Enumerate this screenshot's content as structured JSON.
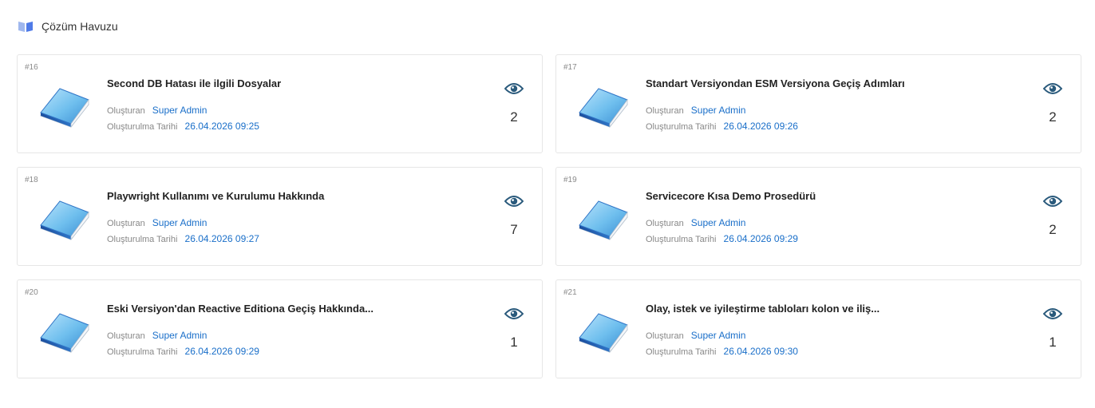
{
  "page": {
    "title": "Çözüm Havuzu",
    "icon": "open-book-icon"
  },
  "labels": {
    "created_by": "Oluşturan",
    "created_at": "Oluşturulma Tarihi"
  },
  "colors": {
    "link": "#1a6fc9",
    "eye": "#2a5a7c",
    "header_icon": "#4f7be8"
  },
  "articles": [
    {
      "id": "#16",
      "title": "Second DB Hatası ile ilgili Dosyalar",
      "author": "Super Admin",
      "date": "26.04.2026 09:25",
      "views": "2",
      "icon": "blue-book-icon"
    },
    {
      "id": "#17",
      "title": "Standart Versiyondan ESM Versiyona Geçiş Adımları",
      "author": "Super Admin",
      "date": "26.04.2026 09:26",
      "views": "2",
      "icon": "blue-book-icon"
    },
    {
      "id": "#18",
      "title": "Playwright Kullanımı ve Kurulumu Hakkında",
      "author": "Super Admin",
      "date": "26.04.2026 09:27",
      "views": "7",
      "icon": "blue-book-icon"
    },
    {
      "id": "#19",
      "title": "Servicecore Kısa Demo Prosedürü",
      "author": "Super Admin",
      "date": "26.04.2026 09:29",
      "views": "2",
      "icon": "blue-book-icon"
    },
    {
      "id": "#20",
      "title": "Eski Versiyon'dan Reactive Editiona Geçiş Hakkında...",
      "author": "Super Admin",
      "date": "26.04.2026 09:29",
      "views": "1",
      "icon": "blue-book-icon"
    },
    {
      "id": "#21",
      "title": "Olay, istek ve iyileştirme tabloları kolon ve iliş...",
      "author": "Super Admin",
      "date": "26.04.2026 09:30",
      "views": "1",
      "icon": "blue-book-icon"
    }
  ]
}
